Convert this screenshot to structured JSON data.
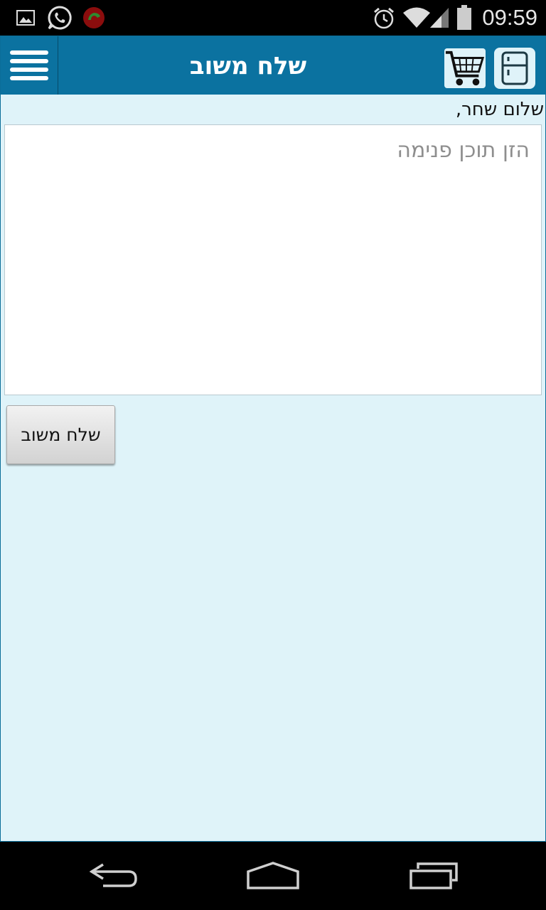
{
  "status_bar": {
    "time": "09:59",
    "icons": [
      "gallery-notification-icon",
      "whatsapp-notification-icon",
      "call-recorder-icon",
      "alarm-icon",
      "wifi-icon",
      "cell-signal-icon",
      "battery-icon"
    ]
  },
  "header": {
    "title": "שלח משוב",
    "menu_icon": "hamburger-menu-icon",
    "cart_icon": "shopping-cart-icon",
    "fridge_icon": "fridge-icon"
  },
  "main": {
    "greeting": "שלום שחר,",
    "feedback_placeholder": "הזן תוכן פנימה",
    "feedback_value": "",
    "send_button_label": "שלח משוב"
  },
  "nav_bar": {
    "icons": [
      "back-icon",
      "home-icon",
      "recent-apps-icon"
    ]
  },
  "colors": {
    "action_bar": "#0b72a0",
    "content_background": "#dff3f9"
  }
}
